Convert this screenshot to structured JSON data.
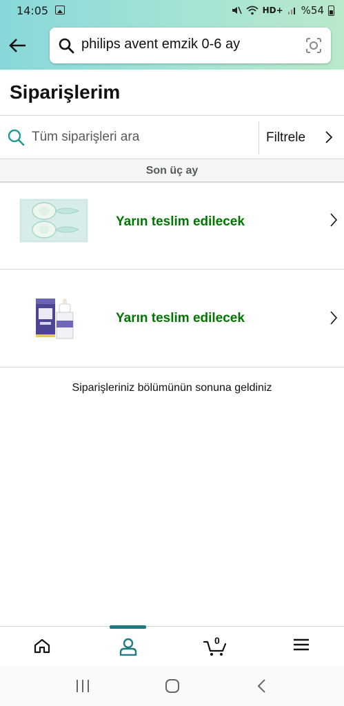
{
  "status_bar": {
    "time": "14:05",
    "network": "HD+",
    "battery": "%54"
  },
  "search": {
    "query": "philips avent emzik 0-6 ay"
  },
  "page": {
    "title": "Siparişlerim"
  },
  "orders_search": {
    "placeholder": "Tüm siparişleri ara",
    "filter_label": "Filtrele"
  },
  "section": {
    "label": "Son üç ay"
  },
  "orders": [
    {
      "status": "Yarın teslim edilecek",
      "image": "pacifier-pack-image"
    },
    {
      "status": "Yarın teslim edilecek",
      "image": "baby-bottle-box-image"
    }
  ],
  "end_message": "Siparişleriniz bölümünün sonuna geldiniz",
  "bottom_nav": {
    "active": "account",
    "items": [
      "home",
      "account",
      "cart",
      "menu"
    ],
    "cart_count": "0"
  },
  "colors": {
    "accent": "#1f7b82",
    "status_green": "#007600",
    "header_gradient_start": "#88d8d9",
    "header_gradient_end": "#b9e9c9"
  }
}
